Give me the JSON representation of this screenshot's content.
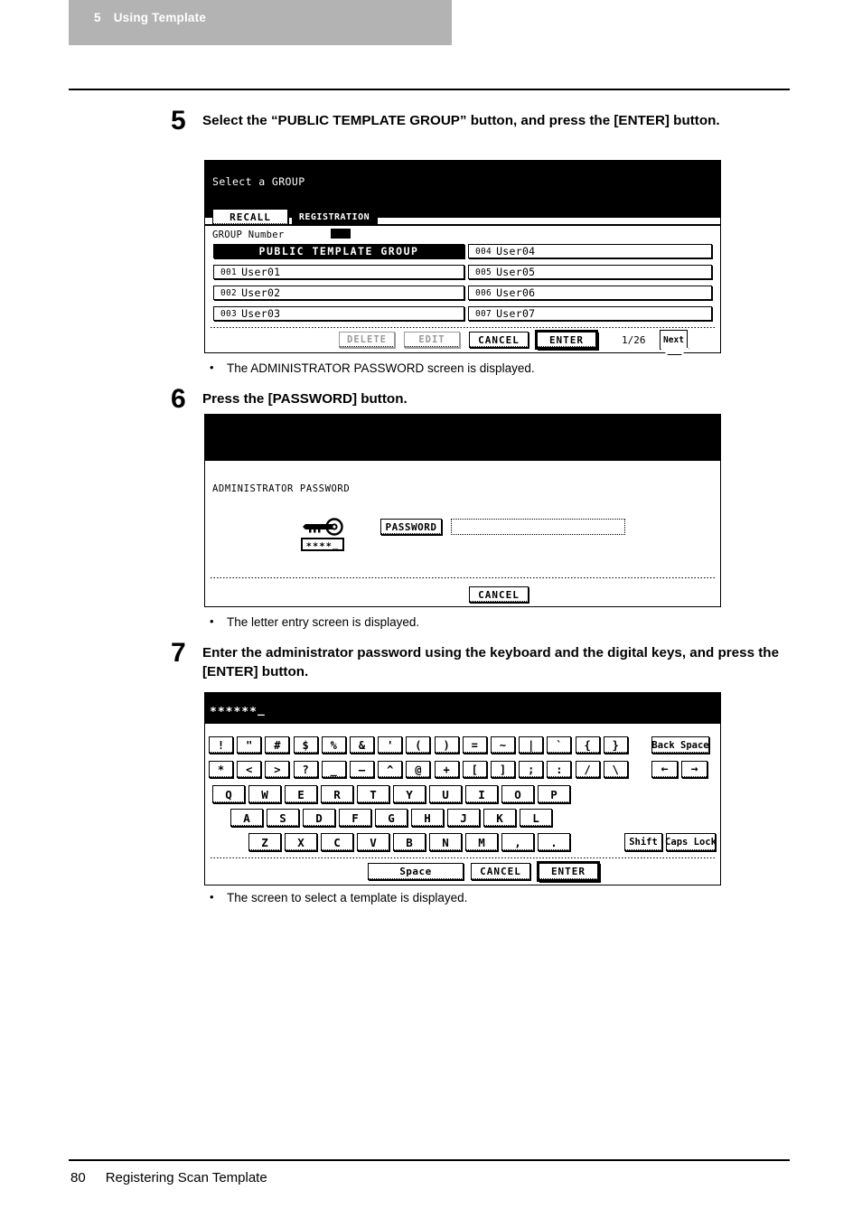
{
  "running_head": {
    "chapter_number": "5",
    "chapter_title": "Using Template"
  },
  "footer": {
    "page_number": "80",
    "section_title": "Registering Scan Template"
  },
  "steps": [
    {
      "number": "5",
      "text": "Select the “PUBLIC TEMPLATE GROUP” button, and press the [ENTER] button.",
      "note": "The ADMINISTRATOR PASSWORD screen is displayed."
    },
    {
      "number": "6",
      "text": "Press the [PASSWORD] button.",
      "note": "The letter entry screen is displayed."
    },
    {
      "number": "7",
      "text": "Enter the administrator password using the keyboard and the digital keys, and press the [ENTER] button.",
      "note": "The screen to select a template is displayed."
    }
  ],
  "screen_group": {
    "title": "Select a GROUP",
    "tabs": [
      {
        "label": "RECALL",
        "selected": false
      },
      {
        "label": "REGISTRATION",
        "selected": true
      }
    ],
    "group_number_label": "GROUP Number",
    "group_number_value": "",
    "list_left": [
      {
        "index": "",
        "name": "PUBLIC TEMPLATE GROUP",
        "selected": true
      },
      {
        "index": "001",
        "name": "User01",
        "selected": false
      },
      {
        "index": "002",
        "name": "User02",
        "selected": false
      },
      {
        "index": "003",
        "name": "User03",
        "selected": false
      }
    ],
    "list_right": [
      {
        "index": "004",
        "name": "User04",
        "selected": false
      },
      {
        "index": "005",
        "name": "User05",
        "selected": false
      },
      {
        "index": "006",
        "name": "User06",
        "selected": false
      },
      {
        "index": "007",
        "name": "User07",
        "selected": false
      }
    ],
    "buttons": [
      {
        "label": "DELETE",
        "disabled": true
      },
      {
        "label": "EDIT",
        "disabled": true
      },
      {
        "label": "CANCEL",
        "disabled": false
      },
      {
        "label": "ENTER",
        "disabled": false,
        "emphasis": true
      }
    ],
    "page_indicator": "1/26",
    "next_label": "Next"
  },
  "screen_password": {
    "title": "",
    "heading": "ADMINISTRATOR PASSWORD",
    "key_icon": "key-icon",
    "masked_sample": "∗∗∗∗_",
    "password_button": "PASSWORD",
    "password_field_value": "",
    "cancel_label": "CANCEL"
  },
  "screen_keyboard": {
    "entry_value": "∗∗∗∗∗∗",
    "cursor": "_",
    "row1": [
      "!",
      "\"",
      "#",
      "$",
      "%",
      "&",
      "'",
      "(",
      ")",
      "=",
      "~",
      "|",
      "`",
      "{",
      "}"
    ],
    "row1_extra": "Back Space",
    "row2": [
      "*",
      "<",
      ">",
      "?",
      "_",
      "—",
      "^",
      "@",
      "+",
      "[",
      "]",
      ";",
      ":",
      "/",
      "\\"
    ],
    "row2_extra": [
      "←",
      "→"
    ],
    "row3": [
      "Q",
      "W",
      "E",
      "R",
      "T",
      "Y",
      "U",
      "I",
      "O",
      "P"
    ],
    "row4": [
      "A",
      "S",
      "D",
      "F",
      "G",
      "H",
      "J",
      "K",
      "L"
    ],
    "row5": [
      "Z",
      "X",
      "C",
      "V",
      "B",
      "N",
      "M",
      ",",
      "."
    ],
    "row5_extra": [
      "Shift",
      "Caps Lock"
    ],
    "bottom": [
      {
        "label": "Space",
        "emphasis": false
      },
      {
        "label": "CANCEL",
        "emphasis": false
      },
      {
        "label": "ENTER",
        "emphasis": true
      }
    ]
  },
  "colors": {
    "runhead_bg": "#b3b3b3",
    "lcd_bg": "#ffffff",
    "lcd_title_bg": "#000000",
    "disabled": "#9a9a9a"
  }
}
